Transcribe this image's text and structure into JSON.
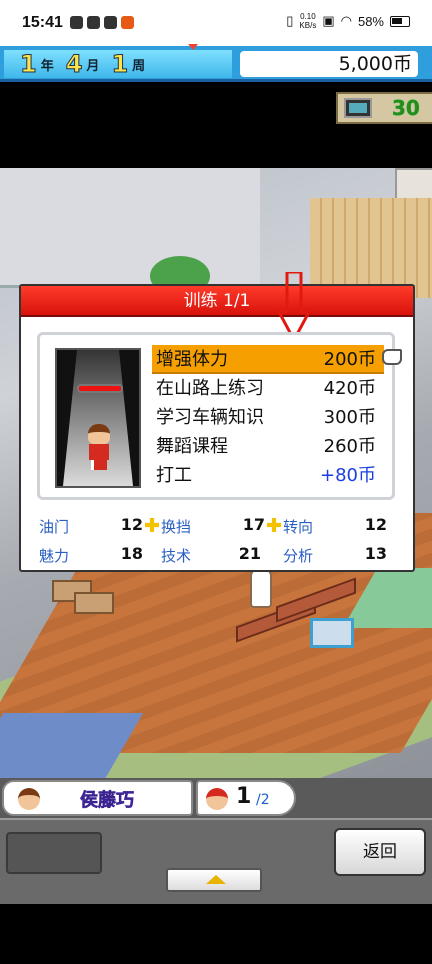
{
  "status_bar": {
    "time": "15:41",
    "net_speed_value": "0.10",
    "net_speed_unit": "KB/s",
    "battery": "58%"
  },
  "top_bar": {
    "year": "1",
    "year_unit": "年",
    "month": "4",
    "month_unit": "月",
    "week": "1",
    "week_unit": "周",
    "money": "5,000币"
  },
  "counter": {
    "icon": "computer-icon",
    "value": "30"
  },
  "dialog": {
    "title": "训练 1/1",
    "menu": [
      {
        "label": "增强体力",
        "cost": "200币",
        "selected": true
      },
      {
        "label": "在山路上练习",
        "cost": "420币"
      },
      {
        "label": "学习车辆知识",
        "cost": "300币"
      },
      {
        "label": "舞蹈课程",
        "cost": "260币"
      },
      {
        "label": "打工",
        "cost": "+80币"
      }
    ],
    "stats": [
      {
        "label": "油门",
        "value": "12"
      },
      {
        "label": "换挡",
        "value": "17"
      },
      {
        "label": "转向",
        "value": "12"
      },
      {
        "label": "魅力",
        "value": "18"
      },
      {
        "label": "技术",
        "value": "21"
      },
      {
        "label": "分析",
        "value": "13"
      }
    ]
  },
  "bottom": {
    "character_name": "侯藤巧",
    "page_current": "1",
    "page_total": "/2",
    "back_label": "返回"
  },
  "colors": {
    "accent_red": "#e11a10",
    "selected_orange": "#f5a000",
    "stat_blue": "#2a5fc2",
    "positive_blue": "#1a3ee0"
  }
}
